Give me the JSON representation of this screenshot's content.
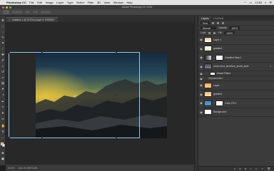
{
  "menubar": {
    "app": "Photoshop CC",
    "items": [
      "File",
      "Edit",
      "Image",
      "Layer",
      "Type",
      "Select",
      "Filter",
      "3D",
      "View",
      "Window",
      "Help"
    ],
    "clock": "13:53"
  },
  "window": {
    "title": "Adobe Photoshop CC 2018"
  },
  "document": {
    "tab_label": "Untitled-1 @ 25.3% (Layer 2, RGB/8) *"
  },
  "status": {
    "zoom": "25.3%",
    "doc_size": "Doc: 24.9M/74.2M"
  },
  "layers_panel": {
    "tabs": [
      "Layers",
      "Channels"
    ],
    "kind_label": "Kind",
    "blend_mode": "Normal",
    "opacity_label": "Opacity:",
    "opacity_value": "100%",
    "lock_label": "Lock:",
    "fill_label": "Fill:",
    "fill_value": "100%",
    "layers": [
      {
        "name": "Layer 1"
      },
      {
        "name": "gradient"
      },
      {
        "name": "Gradient Map 1"
      },
      {
        "name": "photo-shot_lensflare_photo_fade"
      },
      {
        "name": "Smart Filters"
      },
      {
        "name": "Gaussian Blur"
      },
      {
        "name": "Layer"
      },
      {
        "name": "gradient"
      },
      {
        "name": "Color Fill 1"
      },
      {
        "name": "Background"
      }
    ]
  },
  "colors": {
    "foreground": "#e8a322",
    "background": "#ffffff",
    "accent": "#8fc9ef"
  }
}
